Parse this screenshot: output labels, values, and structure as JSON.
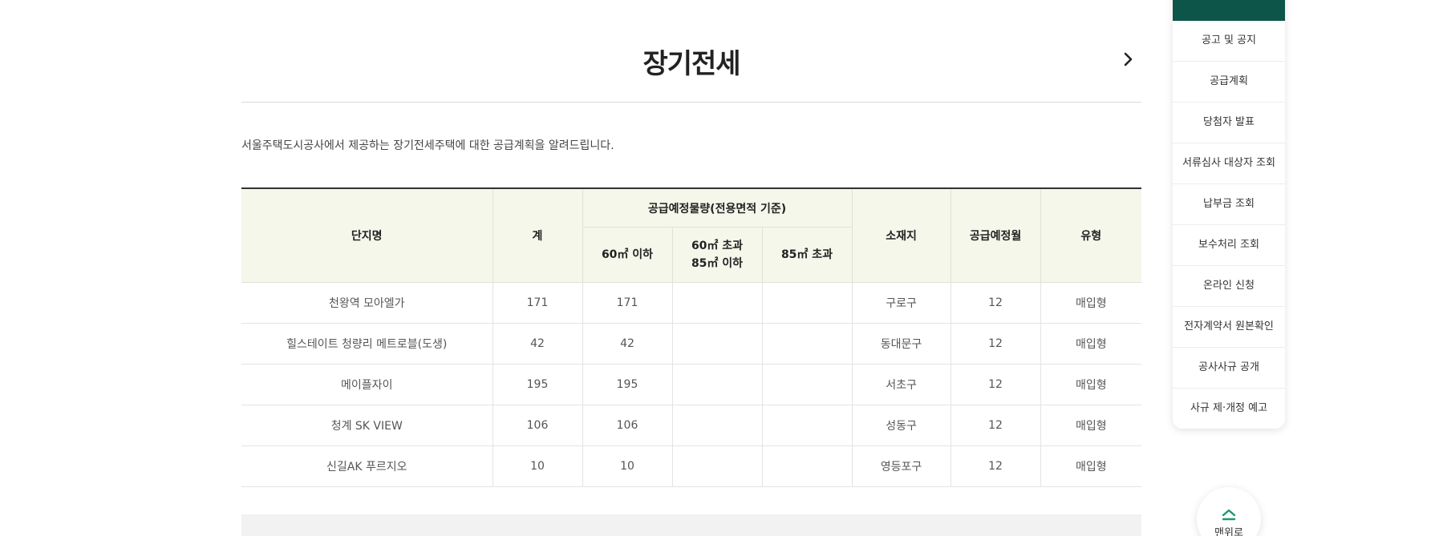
{
  "page": {
    "title": "장기전세",
    "description": "서울주택도시공사에서 제공하는 장기전세주택에 대한 공급계획을 알려드립니다."
  },
  "table": {
    "headers": {
      "complex_name": "단지명",
      "total": "계",
      "supply_group": "공급예정물량(전용면적 기준)",
      "area_60_below": "60㎡ 이하",
      "area_60_85_line1": "60㎡ 초과",
      "area_60_85_line2": "85㎡ 이하",
      "area_85_above": "85㎡ 초과",
      "location": "소재지",
      "supply_month": "공급예정월",
      "type": "유형"
    },
    "rows": [
      {
        "name": "천왕역 모아엘가",
        "total": "171",
        "a60": "171",
        "a60_85": "",
        "a85": "",
        "location": "구로구",
        "month": "12",
        "type": "매입형"
      },
      {
        "name": "힐스테이트 청량리 메트로블(도생)",
        "total": "42",
        "a60": "42",
        "a60_85": "",
        "a85": "",
        "location": "동대문구",
        "month": "12",
        "type": "매입형"
      },
      {
        "name": "메이플자이",
        "total": "195",
        "a60": "195",
        "a60_85": "",
        "a85": "",
        "location": "서초구",
        "month": "12",
        "type": "매입형"
      },
      {
        "name": "청계 SK VIEW",
        "total": "106",
        "a60": "106",
        "a60_85": "",
        "a85": "",
        "location": "성동구",
        "month": "12",
        "type": "매입형"
      },
      {
        "name": "신길AK 푸르지오",
        "total": "10",
        "a60": "10",
        "a60_85": "",
        "a85": "",
        "location": "영등포구",
        "month": "12",
        "type": "매입형"
      }
    ]
  },
  "quick_menu": {
    "items": [
      {
        "label": "공고 및 공지"
      },
      {
        "label": "공급계획"
      },
      {
        "label": "당첨자 발표"
      },
      {
        "label": "서류심사 대상자 조회"
      },
      {
        "label": "납부금 조회"
      },
      {
        "label": "보수처리 조회"
      },
      {
        "label": "온라인 신청"
      },
      {
        "label": "전자계약서 원본확인"
      },
      {
        "label": "공사사규 공개"
      },
      {
        "label": "사규 제·개정 예고"
      }
    ],
    "top_button_label": "맨위로"
  },
  "colors": {
    "accent": "#0d5548",
    "header_bg": "#f4f7ea",
    "top_arrow": "#1f9a6b"
  }
}
